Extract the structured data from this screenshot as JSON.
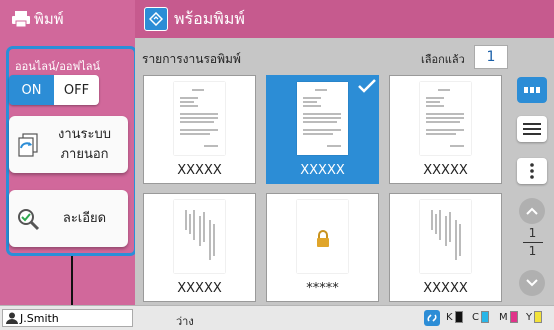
{
  "app": {
    "name": "พิมพ์",
    "title": "พร้อมพิมพ์"
  },
  "sidebar": {
    "panel_label": "ออนไลน์/ออฟไลน์",
    "toggle": {
      "on_label": "ON",
      "off_label": "OFF",
      "selected": "ON"
    },
    "external_button_line1": "งานระบบ",
    "external_button_line2": "ภายนอก",
    "details_button": "ละเอียด"
  },
  "main": {
    "list_title": "รายการงานรอพิมพ์",
    "selected_label": "เลือกแล้ว",
    "selected_count": "1",
    "jobs": [
      {
        "name": "XXXXX",
        "selected": false,
        "locked": false
      },
      {
        "name": "XXXXX",
        "selected": true,
        "locked": false
      },
      {
        "name": "XXXXX",
        "selected": false,
        "locked": false
      },
      {
        "name": "XXXXX",
        "selected": false,
        "locked": false
      },
      {
        "name": "*****",
        "selected": false,
        "locked": true
      },
      {
        "name": "XXXXX",
        "selected": false,
        "locked": false
      }
    ],
    "pager": {
      "current": "1",
      "total": "1"
    }
  },
  "footer": {
    "user": "J.Smith",
    "status": "ว่าง",
    "inks": [
      {
        "label": "K",
        "color": "#111111"
      },
      {
        "label": "C",
        "color": "#29b6e8"
      },
      {
        "label": "M",
        "color": "#e0338a"
      },
      {
        "label": "Y",
        "color": "#f2e23a"
      }
    ]
  },
  "colors": {
    "accent": "#2c8dd6",
    "header": "#c65a8e",
    "sidebar": "#d1689b"
  }
}
